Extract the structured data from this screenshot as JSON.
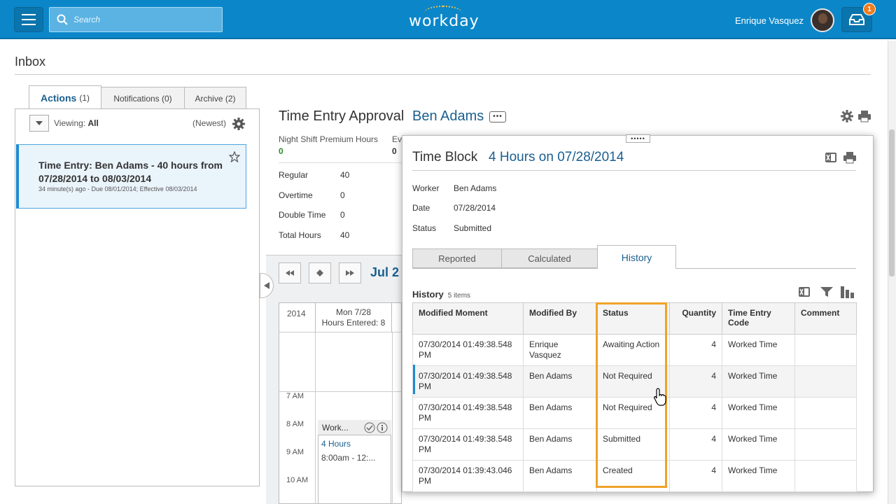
{
  "header": {
    "search_placeholder": "Search",
    "logo_text": "workday",
    "user_name": "Enrique Vasquez",
    "notification_count": "1",
    "brand_color": "#0b87c9",
    "icons": [
      "menu-icon",
      "search-icon",
      "inbox-icon"
    ]
  },
  "page": {
    "title": "Inbox"
  },
  "inbox_tabs": [
    {
      "label": "Actions",
      "count": "(1)"
    },
    {
      "label": "Notifications (0)"
    },
    {
      "label": "Archive (2)"
    }
  ],
  "left_panel": {
    "viewing_label": "Viewing:",
    "viewing_value": "All",
    "sort": "(Newest)",
    "item": {
      "title": "Time Entry: Ben Adams - 40 hours from 07/28/2014 to 08/03/2014",
      "subtitle": "34 minute(s) ago - Due 08/01/2014; Effective 08/03/2014"
    }
  },
  "time_entry": {
    "title": "Time Entry Approval",
    "name": "Ben Adams",
    "more": "•••",
    "summary": [
      {
        "label": "Night Shift Premium Hours",
        "value": "0"
      },
      {
        "label": "Ev",
        "value": "0"
      }
    ],
    "hours": [
      {
        "label": "Regular",
        "value": "40"
      },
      {
        "label": "Overtime",
        "value": "0"
      },
      {
        "label": "Double Time",
        "value": "0"
      },
      {
        "label": "Total Hours",
        "value": "40"
      }
    ],
    "calendar": {
      "month": "Jul 2",
      "year": "2014",
      "day_label": "Mon 7/28",
      "day_hours": "Hours Entered: 8",
      "times": [
        "7 AM",
        "8 AM",
        "9 AM",
        "10 AM"
      ],
      "block_title": "Work...",
      "block_hours": "4 Hours",
      "block_time": "8:00am - 12:..."
    }
  },
  "popup": {
    "drag_handle": "•••••",
    "title": "Time Block",
    "subtitle": "4 Hours on 07/28/2014",
    "fields": [
      {
        "label": "Worker",
        "value": "Ben Adams"
      },
      {
        "label": "Date",
        "value": "07/28/2014"
      },
      {
        "label": "Status",
        "value": "Submitted"
      }
    ],
    "tabs": [
      "Reported",
      "Calculated",
      "History"
    ],
    "history_label": "History",
    "history_count": "5 items",
    "columns": [
      "Modified Moment",
      "Modified By",
      "Status",
      "Quantity",
      "Time Entry Code",
      "Comment"
    ],
    "rows": [
      {
        "moment": "07/30/2014 01:49:38.548 PM",
        "by": "Enrique Vasquez",
        "status": "Awaiting Action",
        "qty": "4",
        "code": "Worked Time",
        "comment": ""
      },
      {
        "moment": "07/30/2014 01:49:38.548 PM",
        "by": "Ben Adams",
        "status": "Not Required",
        "qty": "4",
        "code": "Worked Time",
        "comment": ""
      },
      {
        "moment": "07/30/2014 01:49:38.548 PM",
        "by": "Ben Adams",
        "status": "Not Required",
        "qty": "4",
        "code": "Worked Time",
        "comment": ""
      },
      {
        "moment": "07/30/2014 01:49:38.548 PM",
        "by": "Ben Adams",
        "status": "Submitted",
        "qty": "4",
        "code": "Worked Time",
        "comment": ""
      },
      {
        "moment": "07/30/2014 01:39:43.046 PM",
        "by": "Ben Adams",
        "status": "Created",
        "qty": "4",
        "code": "Worked Time",
        "comment": ""
      }
    ],
    "highlight_color": "#f0a22a"
  }
}
